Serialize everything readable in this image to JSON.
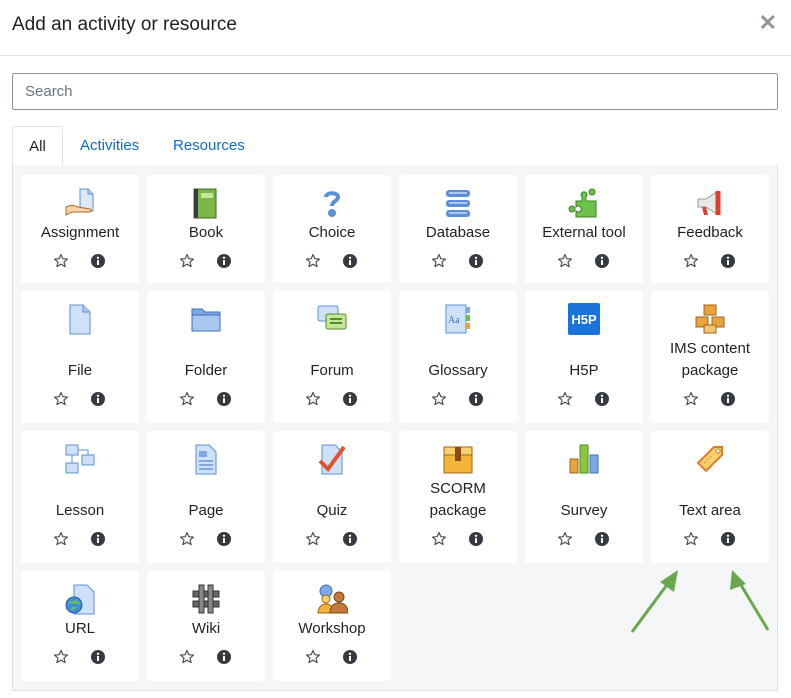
{
  "dialog": {
    "title": "Add an activity or resource",
    "close_glyph": "✕"
  },
  "search": {
    "placeholder": "Search",
    "value": ""
  },
  "tabs": [
    {
      "label": "All",
      "active": true
    },
    {
      "label": "Activities",
      "active": false
    },
    {
      "label": "Resources",
      "active": false
    }
  ],
  "colors": {
    "link": "#0f6cbf",
    "border": "#dee2e6",
    "panel_bg": "#f5f6f8",
    "arrow": "#6aa84f"
  },
  "modules": [
    {
      "name": "Assignment",
      "icon": "assignment-icon"
    },
    {
      "name": "Book",
      "icon": "book-icon"
    },
    {
      "name": "Choice",
      "icon": "choice-icon"
    },
    {
      "name": "Database",
      "icon": "database-icon"
    },
    {
      "name": "External tool",
      "icon": "external-tool-icon"
    },
    {
      "name": "Feedback",
      "icon": "feedback-icon"
    },
    {
      "name": "File",
      "icon": "file-icon"
    },
    {
      "name": "Folder",
      "icon": "folder-icon"
    },
    {
      "name": "Forum",
      "icon": "forum-icon"
    },
    {
      "name": "Glossary",
      "icon": "glossary-icon"
    },
    {
      "name": "H5P",
      "icon": "h5p-icon",
      "icon_text": "H5P"
    },
    {
      "name": "IMS content package",
      "icon": "ims-package-icon"
    },
    {
      "name": "Lesson",
      "icon": "lesson-icon"
    },
    {
      "name": "Page",
      "icon": "page-icon"
    },
    {
      "name": "Quiz",
      "icon": "quiz-icon"
    },
    {
      "name": "SCORM package",
      "icon": "scorm-icon"
    },
    {
      "name": "Survey",
      "icon": "survey-icon"
    },
    {
      "name": "Text area",
      "icon": "text-area-icon"
    },
    {
      "name": "URL",
      "icon": "url-icon"
    },
    {
      "name": "Wiki",
      "icon": "wiki-icon"
    },
    {
      "name": "Workshop",
      "icon": "workshop-icon"
    }
  ]
}
